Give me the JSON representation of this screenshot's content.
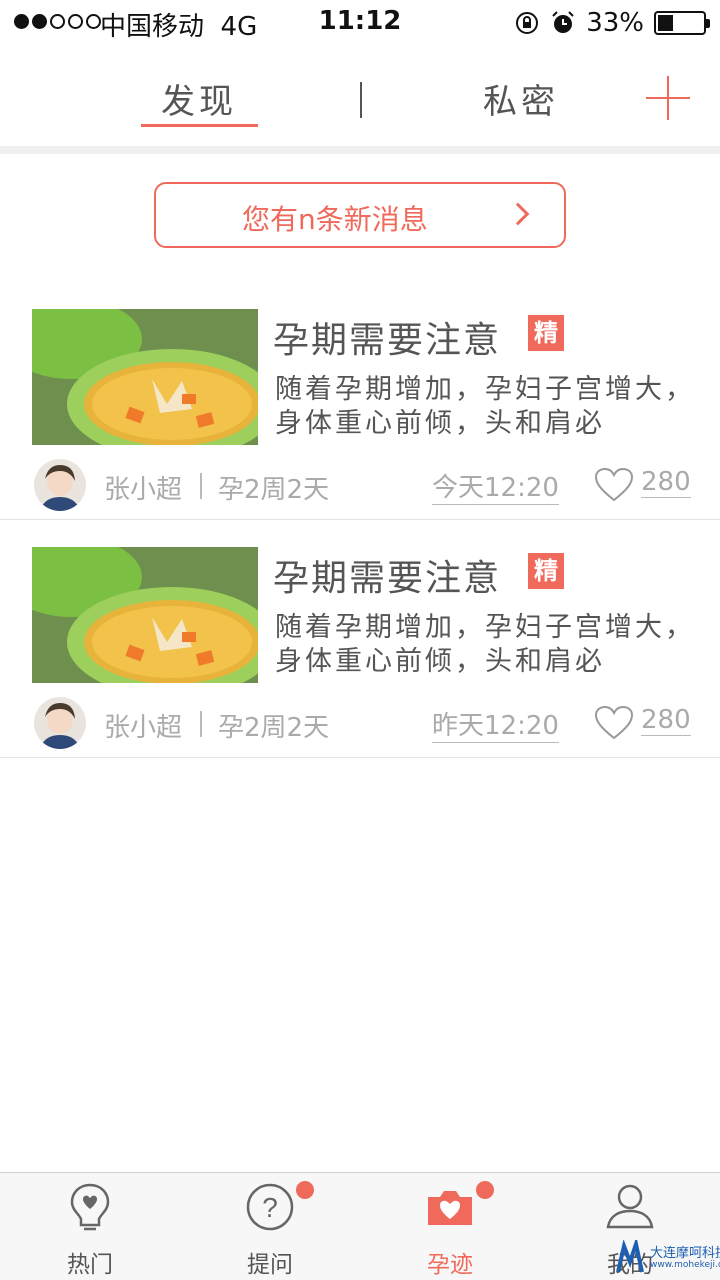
{
  "status_bar": {
    "carrier": "中国移动",
    "network": "4G",
    "time": "11:12",
    "battery_percent": "33%",
    "battery_level": 0.33
  },
  "top_tabs": {
    "discover": "发现",
    "private": "私密",
    "add_icon": "plus-icon"
  },
  "message_banner": {
    "text": "您有n条新消息"
  },
  "posts": [
    {
      "title": "孕期需要注意",
      "badge": "精",
      "excerpt": "随着孕期增加，孕妇子宫增大，身体重心前倾，头和肩必",
      "author": "张小超",
      "stage": "孕2周2天",
      "time": "今天12:20",
      "likes": "280"
    },
    {
      "title": "孕期需要注意",
      "badge": "精",
      "excerpt": "随着孕期增加，孕妇子宫增大，身体重心前倾，头和肩必",
      "author": "张小超",
      "stage": "孕2周2天",
      "time": "昨天12:20",
      "likes": "280"
    }
  ],
  "tab_bar": {
    "items": [
      {
        "label": "热门",
        "icon": "lightbulb-heart-icon"
      },
      {
        "label": "提问",
        "icon": "question-circle-icon"
      },
      {
        "label": "孕迹",
        "icon": "camera-heart-icon"
      },
      {
        "label": "我的",
        "icon": "user-icon"
      }
    ]
  },
  "watermark": {
    "text": "大连摩呵科技",
    "url": "www.mohekeji.com"
  },
  "colors": {
    "accent": "#ef6a5b",
    "text": "#555555",
    "muted": "#aaaaaa"
  }
}
